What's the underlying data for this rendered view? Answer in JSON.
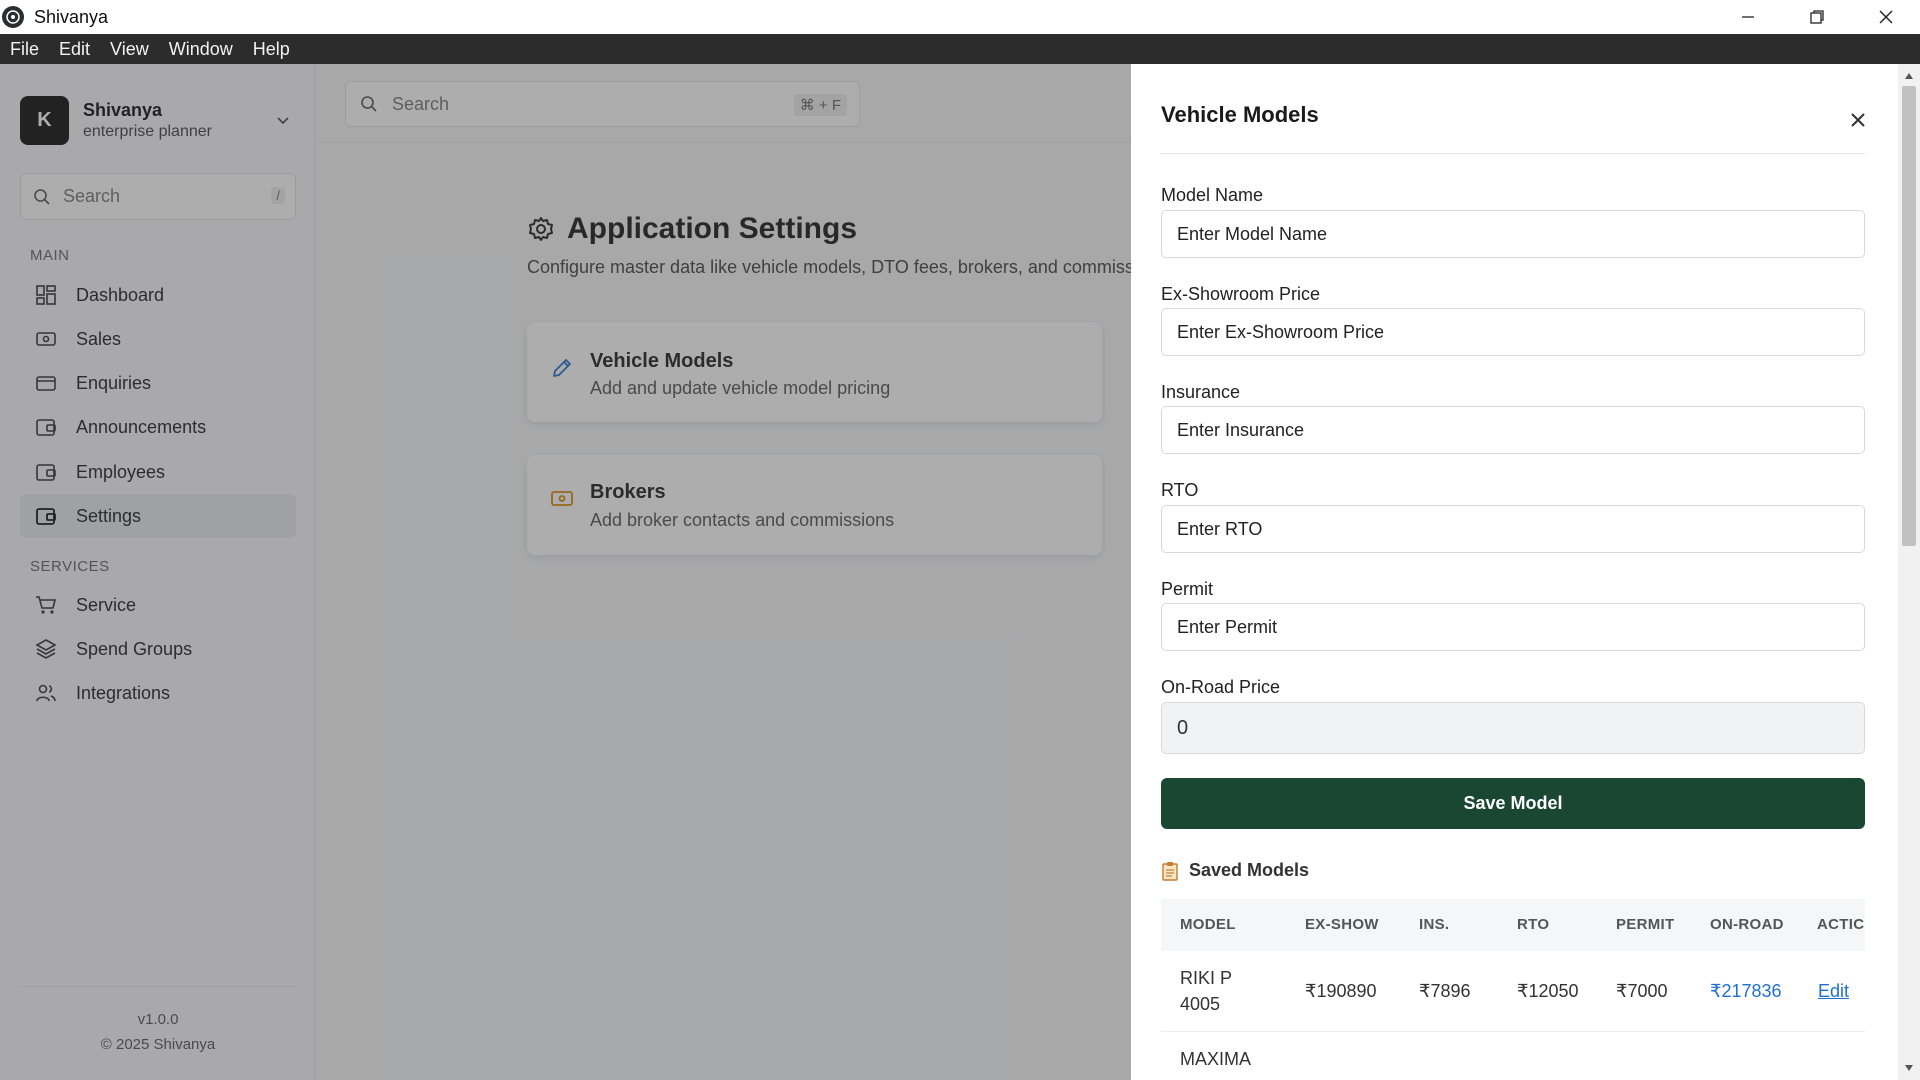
{
  "window": {
    "title": "Shivanya"
  },
  "menu": [
    "File",
    "Edit",
    "View",
    "Window",
    "Help"
  ],
  "org": {
    "initial": "K",
    "name": "Shivanya",
    "subtitle": "enterprise planner"
  },
  "sidebar": {
    "search_placeholder": "Search",
    "search_shortcut": "/",
    "main_label": "MAIN",
    "main_items": [
      {
        "label": "Dashboard",
        "icon": "grid-icon"
      },
      {
        "label": "Sales",
        "icon": "cash-icon"
      },
      {
        "label": "Enquiries",
        "icon": "card-icon"
      },
      {
        "label": "Announcements",
        "icon": "wallet-icon"
      },
      {
        "label": "Employees",
        "icon": "wallet-icon"
      },
      {
        "label": "Settings",
        "icon": "wallet-icon",
        "active": true
      }
    ],
    "services_label": "SERVICES",
    "services_items": [
      {
        "label": "Service",
        "icon": "cart-icon"
      },
      {
        "label": "Spend Groups",
        "icon": "layers-icon"
      },
      {
        "label": "Integrations",
        "icon": "users-icon"
      }
    ],
    "version": "v1.0.0",
    "copyright": "© 2025 Shivanya"
  },
  "topbar": {
    "search_placeholder": "Search",
    "shortcut": "⌘ + F"
  },
  "page": {
    "title": "Application Settings",
    "description": "Configure master data like vehicle models, DTO fees, brokers, and commiss",
    "cards": [
      {
        "title": "Vehicle Models",
        "subtitle": "Add and update vehicle model pricing",
        "icon": "pencil-icon"
      },
      {
        "title": "Brokers",
        "subtitle": "Add broker contacts and commissions",
        "icon": "cash-icon"
      }
    ]
  },
  "modal": {
    "title": "Vehicle Models",
    "fields": [
      {
        "label": "Model Name",
        "placeholder": "Enter Model Name"
      },
      {
        "label": "Ex-Showroom Price",
        "placeholder": "Enter Ex-Showroom Price"
      },
      {
        "label": "Insurance",
        "placeholder": "Enter Insurance"
      },
      {
        "label": "RTO",
        "placeholder": "Enter RTO"
      },
      {
        "label": "Permit",
        "placeholder": "Enter Permit"
      }
    ],
    "on_road_label": "On-Road Price",
    "on_road_value": "0",
    "save_label": "Save Model",
    "saved_title": "Saved Models",
    "saved_icon": "clipboard-icon",
    "table": {
      "headers": [
        "MODEL",
        "EX-SHOW",
        "INS.",
        "RTO",
        "PERMIT",
        "ON-ROAD",
        "ACTIC"
      ],
      "rows": [
        {
          "model": "RIKI P 4005",
          "ex_show": "₹190890",
          "ins": "₹7896",
          "rto": "₹12050",
          "permit": "₹7000",
          "on_road": "₹217836",
          "action": "Edit"
        },
        {
          "model": "MAXIMA",
          "ex_show": "",
          "ins": "",
          "rto": "",
          "permit": "",
          "on_road": "",
          "action": ""
        }
      ]
    }
  },
  "colors": {
    "accent_green": "#1a4731",
    "link_blue": "#1f6fd1",
    "menubar": "#2c2c2c"
  }
}
